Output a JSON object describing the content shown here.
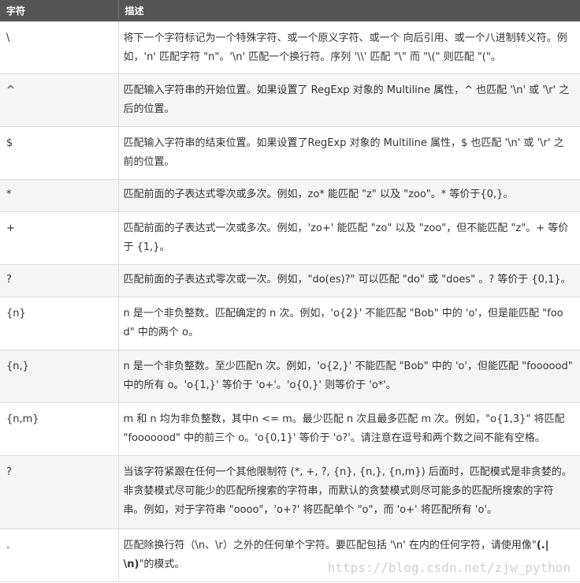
{
  "table": {
    "headers": [
      "字符",
      "描述"
    ],
    "rows": [
      {
        "char": "\\",
        "desc": "将下一个字符标记为一个特殊字符、或一个原义字符、或一个 向后引用、或一个八进制转义符。例如，'n' 匹配字符 \"n\"。'\\n' 匹配一个换行符。序列 '\\\\' 匹配 \"\\\" 而 \"\\(\" 则匹配 \"(\"。"
      },
      {
        "char": "^",
        "desc": "匹配输入字符串的开始位置。如果设置了 RegExp 对象的 Multiline 属性，^ 也匹配 '\\n' 或 '\\r' 之后的位置。"
      },
      {
        "char": "$",
        "desc": "匹配输入字符串的结束位置。如果设置了RegExp 对象的 Multiline 属性，$ 也匹配 '\\n' 或 '\\r' 之前的位置。"
      },
      {
        "char": "*",
        "desc": "匹配前面的子表达式零次或多次。例如，zo* 能匹配 \"z\" 以及 \"zoo\"。* 等价于{0,}。"
      },
      {
        "char": "+",
        "desc": "匹配前面的子表达式一次或多次。例如，'zo+' 能匹配 \"zo\" 以及 \"zoo\"，但不能匹配 \"z\"。+ 等价于 {1,}。"
      },
      {
        "char": "?",
        "desc": "匹配前面的子表达式零次或一次。例如，\"do(es)?\" 可以匹配 \"do\" 或 \"does\" 。? 等价于 {0,1}。"
      },
      {
        "char": "{n}",
        "desc": "n 是一个非负整数。匹配确定的 n 次。例如，'o{2}' 不能匹配 \"Bob\" 中的 'o'，但是能匹配 \"food\" 中的两个 o。"
      },
      {
        "char": "{n,}",
        "desc": "n 是一个非负整数。至少匹配n 次。例如，'o{2,}' 不能匹配 \"Bob\" 中的 'o'，但能匹配 \"foooood\" 中的所有 o。'o{1,}' 等价于 'o+'。'o{0,}' 则等价于 'o*'。"
      },
      {
        "char": "{n,m}",
        "desc": "m 和 n 均为非负整数，其中n <= m。最少匹配 n 次且最多匹配 m 次。例如，\"o{1,3}\" 将匹配 \"fooooood\" 中的前三个 o。'o{0,1}' 等价于 'o?'。请注意在逗号和两个数之间不能有空格。"
      },
      {
        "char": "?",
        "desc": "当该字符紧跟在任何一个其他限制符 (*, +, ?, {n}, {n,}, {n,m}) 后面时，匹配模式是非贪婪的。非贪婪模式尽可能少的匹配所搜索的字符串，而默认的贪婪模式则尽可能多的匹配所搜索的字符串。例如，对于字符串 \"oooo\"，'o+?' 将匹配单个 \"o\"，而 'o+' 将匹配所有 'o'。"
      },
      {
        "char": ".",
        "desc_prefix": "匹配除换行符（\\n、\\r）之外的任何单个字符。要匹配包括 '\\n' 在内的任何字符，请使用像\"",
        "desc_bold": "(.|\\n)",
        "desc_suffix": "\"的模式。"
      }
    ]
  },
  "watermark": "https://blog.csdn.net/zjw_python"
}
